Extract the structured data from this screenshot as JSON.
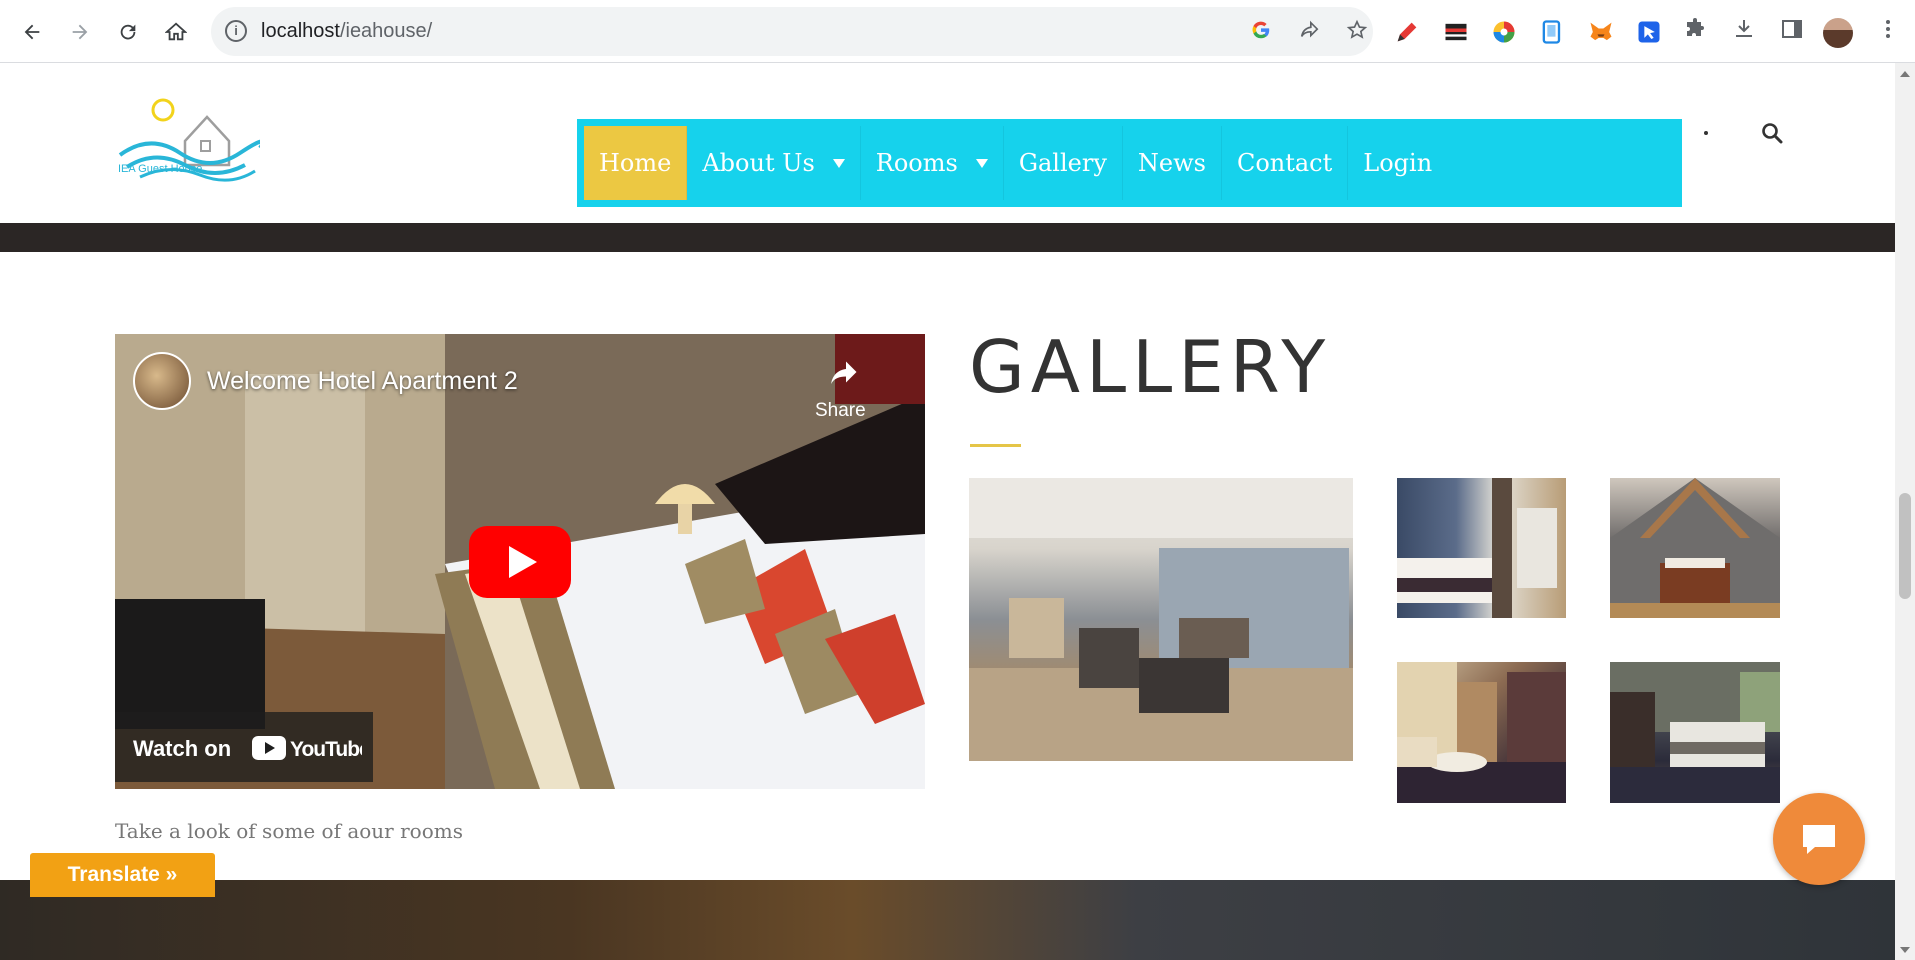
{
  "browser": {
    "url_host": "localhost",
    "url_path": "/ieahouse/"
  },
  "site": {
    "logo_text": "IEA Guest House",
    "menu": [
      {
        "label": "Home",
        "active": true,
        "has_dropdown": false
      },
      {
        "label": "About Us",
        "active": false,
        "has_dropdown": true
      },
      {
        "label": "Rooms",
        "active": false,
        "has_dropdown": true
      },
      {
        "label": "Gallery",
        "active": false,
        "has_dropdown": false
      },
      {
        "label": "News",
        "active": false,
        "has_dropdown": false
      },
      {
        "label": "Contact",
        "active": false,
        "has_dropdown": false
      },
      {
        "label": "Login",
        "active": false,
        "has_dropdown": false
      }
    ]
  },
  "video": {
    "title": "Welcome Hotel Apartment 2",
    "share_label": "Share",
    "watch_on_label": "Watch on",
    "youtube_label": "YouTube"
  },
  "content": {
    "caption": "Take a look of some of aour rooms",
    "gallery_title": "GALLERY"
  },
  "widgets": {
    "translate_label": "Translate »"
  },
  "colors": {
    "menu_bg": "#16d2ec",
    "menu_active": "#ecc842",
    "accent": "#e5c547",
    "translate_bg": "#f2a114",
    "chat_bg": "#ef8a3a"
  }
}
